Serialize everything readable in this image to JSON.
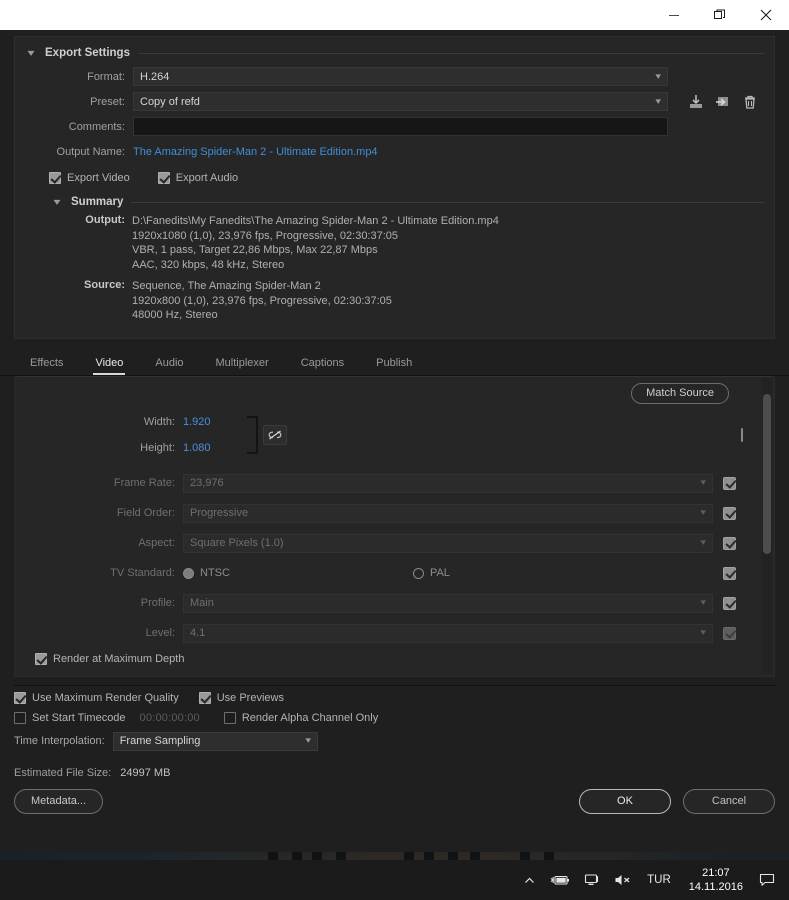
{
  "titlebar": {
    "minimize": "—",
    "restore": "❐",
    "close": "✕"
  },
  "export_settings": {
    "title": "Export Settings",
    "format_label": "Format:",
    "format_value": "H.264",
    "preset_label": "Preset:",
    "preset_value": "Copy of refd",
    "comments_label": "Comments:",
    "comments_value": "",
    "output_name_label": "Output Name:",
    "output_name_value": "The Amazing Spider-Man 2 - Ultimate Edition.mp4",
    "export_video_label": "Export Video",
    "export_video_checked": true,
    "export_audio_label": "Export Audio",
    "export_audio_checked": true,
    "preset_actions": {
      "save_preset": "save-preset-icon",
      "import_preset": "import-preset-icon",
      "delete_preset": "delete-preset-icon"
    }
  },
  "summary": {
    "title": "Summary",
    "output_key": "Output:",
    "output_lines": [
      "D:\\Fanedits\\My Fanedits\\The Amazing Spider-Man 2 - Ultimate Edition.mp4",
      "1920x1080 (1,0), 23,976 fps, Progressive, 02:30:37:05",
      "VBR, 1 pass, Target 22,86 Mbps, Max 22,87 Mbps",
      "AAC, 320 kbps, 48 kHz, Stereo"
    ],
    "source_key": "Source:",
    "source_lines": [
      "Sequence, The Amazing Spider-Man 2",
      "1920x800 (1,0), 23,976 fps, Progressive, 02:30:37:05",
      "48000 Hz, Stereo"
    ]
  },
  "tabs": [
    {
      "label": "Effects",
      "active": false
    },
    {
      "label": "Video",
      "active": true
    },
    {
      "label": "Audio",
      "active": false
    },
    {
      "label": "Multiplexer",
      "active": false
    },
    {
      "label": "Captions",
      "active": false
    },
    {
      "label": "Publish",
      "active": false
    }
  ],
  "video_settings": {
    "match_source_label": "Match Source",
    "width_label": "Width:",
    "width_value": "1.920",
    "height_label": "Height:",
    "height_value": "1.080",
    "link_icon": "broken-link-icon",
    "dimension_checkbox_checked": false,
    "fields": [
      {
        "label": "Frame Rate:",
        "value": "23,976",
        "checked": true,
        "disabled": true
      },
      {
        "label": "Field Order:",
        "value": "Progressive",
        "checked": true,
        "disabled": true
      },
      {
        "label": "Aspect:",
        "value": "Square Pixels (1.0)",
        "checked": true,
        "disabled": true
      }
    ],
    "tv_standard": {
      "label": "TV Standard:",
      "ntsc_label": "NTSC",
      "pal_label": "PAL",
      "selected": "NTSC",
      "checked": true
    },
    "fields2": [
      {
        "label": "Profile:",
        "value": "Main",
        "checked": true,
        "disabled": true
      },
      {
        "label": "Level:",
        "value": "4.1",
        "checked": true,
        "disabled": true,
        "dim_check": true
      }
    ],
    "render_max_depth_label": "Render at Maximum Depth",
    "render_max_depth_checked": true
  },
  "bottom_options": {
    "use_max_render_quality_label": "Use Maximum Render Quality",
    "use_max_render_quality_checked": true,
    "use_previews_label": "Use Previews",
    "use_previews_checked": true,
    "set_start_timecode_label": "Set Start Timecode",
    "set_start_timecode_checked": false,
    "timecode_value": "00:00:00:00",
    "render_alpha_label": "Render Alpha Channel Only",
    "render_alpha_checked": false,
    "time_interpolation_label": "Time Interpolation:",
    "time_interpolation_value": "Frame Sampling"
  },
  "footer": {
    "estimated_label": "Estimated File Size:",
    "estimated_value": "24997 MB",
    "metadata_label": "Metadata...",
    "ok_label": "OK",
    "cancel_label": "Cancel"
  },
  "taskbar": {
    "show_hidden_icons": "chevron-up-icon",
    "battery": "battery-charging-icon",
    "network": "network-icon",
    "volume": "volume-muted-icon",
    "language": "TUR",
    "time": "21:07",
    "date": "14.11.2016",
    "action_center": "action-center-icon"
  },
  "colors": {
    "link_blue": "#3f8fd6",
    "value_blue": "#4a90d9",
    "panel_bg": "#262626",
    "dialog_bg": "#1f1f1f"
  }
}
